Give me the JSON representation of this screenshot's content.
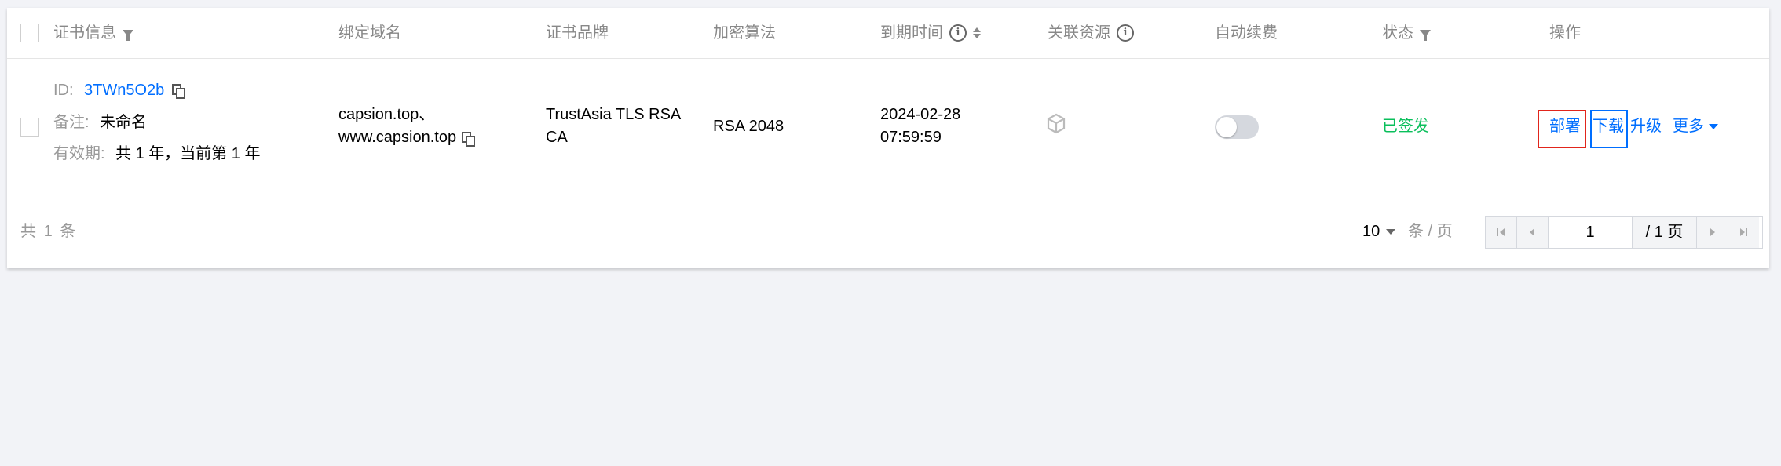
{
  "header": {
    "cert_info": "证书信息",
    "domain": "绑定域名",
    "brand": "证书品牌",
    "algorithm": "加密算法",
    "expiry": "到期时间",
    "resources": "关联资源",
    "auto_renew": "自动续费",
    "status": "状态",
    "actions": "操作"
  },
  "row": {
    "id_label": "ID:",
    "id_value": "3TWn5O2b",
    "remark_label": "备注:",
    "remark_value": "未命名",
    "validity_label": "有效期:",
    "validity_value": "共 1 年，当前第 1 年",
    "domain_line1": "capsion.top、",
    "domain_line2": "www.capsion.top",
    "brand_line1": "TrustAsia TLS RSA",
    "brand_line2": "CA",
    "algorithm": "RSA 2048",
    "expiry_date": "2024-02-28",
    "expiry_time": "07:59:59",
    "auto_renew_on": false,
    "status": "已签发",
    "actions": {
      "deploy": "部署",
      "download": "下载",
      "upgrade": "升级",
      "more": "更多"
    }
  },
  "footer": {
    "total_prefix": "共",
    "total_count": "1",
    "total_suffix": "条",
    "page_size": "10",
    "page_size_unit": "条 / 页",
    "current_page": "1",
    "total_pages": "/ 1 页"
  },
  "colors": {
    "link": "#006eff",
    "status_signed": "#0abf5b",
    "highlight_red": "#e1251b",
    "highlight_blue": "#006eff"
  }
}
